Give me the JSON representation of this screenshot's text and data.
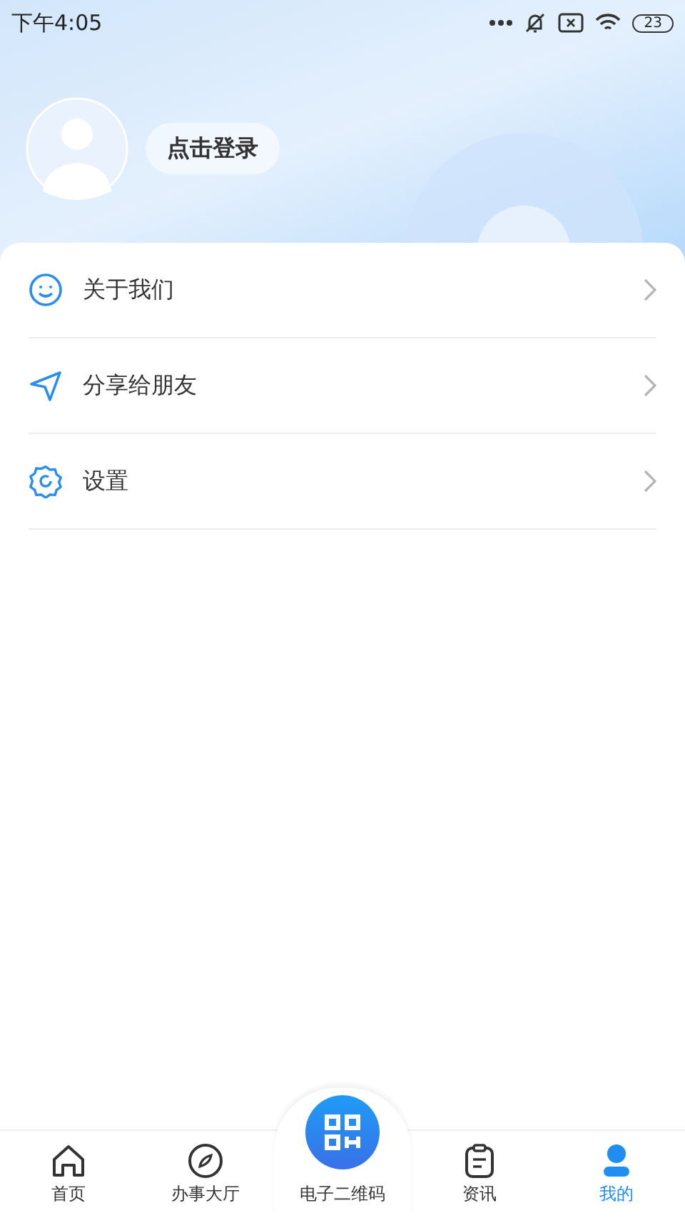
{
  "status_bar": {
    "time": "下午4:05",
    "battery": "23"
  },
  "profile": {
    "login_label": "点击登录"
  },
  "menu": [
    {
      "kind": "about",
      "label": "关于我们"
    },
    {
      "kind": "share",
      "label": "分享给朋友"
    },
    {
      "kind": "settings",
      "label": "设置"
    }
  ],
  "tab_bar": [
    {
      "kind": "home",
      "label": "首页",
      "selected": false
    },
    {
      "kind": "compass",
      "label": "办事大厅",
      "selected": false
    },
    {
      "kind": "qr",
      "label": "电子二维码",
      "selected": false
    },
    {
      "kind": "news",
      "label": "资讯",
      "selected": false
    },
    {
      "kind": "user",
      "label": "我的",
      "selected": true
    }
  ]
}
